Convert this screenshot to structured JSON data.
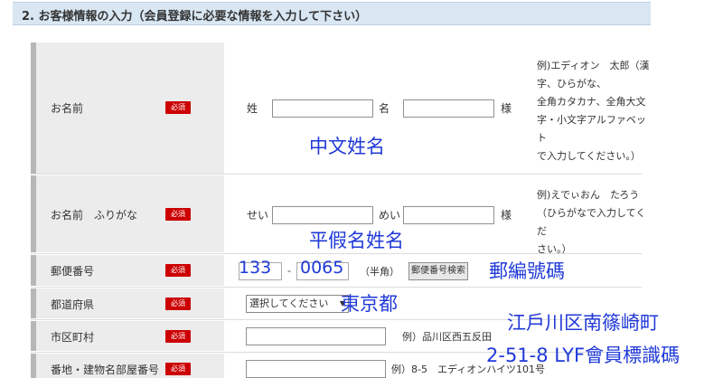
{
  "section": {
    "title": "2. お客様情報の入力（会員登録に必要な情報を入力して下さい）"
  },
  "required_badge": "必須",
  "rows": {
    "name": {
      "label": "お名前",
      "sei_label": "姓",
      "mei_label": "名",
      "suffix": "様",
      "sei_value": "",
      "mei_value": "",
      "note_lines": [
        "例)エディオン　太郎（漢",
        "字、ひらがな、",
        "全角カタカナ、全角大文",
        "字・小文字アルファベット",
        "で入力してください。）"
      ]
    },
    "furigana": {
      "label": "お名前　ふりがな",
      "sei_label": "せい",
      "mei_label": "めい",
      "suffix": "様",
      "sei_value": "",
      "mei_value": "",
      "note_lines": [
        "例)えでぃおん　たろう",
        "（ひらがなで入力してくだ",
        "さい。）"
      ]
    },
    "zip": {
      "label": "郵便番号",
      "value1": "133",
      "hyphen": "-",
      "value2": "0065",
      "hankaku": "（半角）",
      "search_button": "郵便番号検索"
    },
    "prefecture": {
      "label": "都道府県",
      "selected": "選択してください"
    },
    "city": {
      "label": "市区町村",
      "value": "",
      "example": "例）品川区西五反田"
    },
    "address": {
      "label": "番地・建物名部屋番号",
      "value": "",
      "example": "例）8-5　エディオンハイツ101号"
    }
  },
  "annotations": {
    "name": "中文姓名",
    "furigana": "平假名姓名",
    "zip": "郵編號碼",
    "prefecture": "東京都",
    "city": "江戶川区南篠崎町",
    "address": "2-51-8 LYF會員標識碼"
  },
  "colors": {
    "annotation": "#1f39d8",
    "badge": "#cc0000",
    "header_bg": "#d9e7f3",
    "label_bg": "#ececec"
  }
}
